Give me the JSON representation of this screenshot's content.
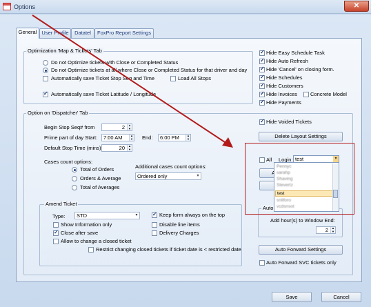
{
  "window": {
    "title": "Options",
    "close_glyph": "✕"
  },
  "tabs": [
    "General",
    "User Profile",
    "Datatel",
    "FoxPro Report Settings"
  ],
  "optimization": {
    "title": "Optimization 'Map & Tickets' Tab",
    "radio1": "Do not Optimize tickets with Close or Completed Status",
    "radio2": "Do not Optimize  tickets at all where Close or Completed Status for that driver and day",
    "auto_save_stop": "Automatically save Ticket Stop Seq and Time",
    "load_all_stops": "Load All Stops",
    "auto_save_latlong": "Automatically save Ticket Latitude / Longitude"
  },
  "right_checks": [
    "Hide Easy Schedule Task",
    "Hide Auto Refresh",
    "Hide 'Cancel' on closing form.",
    "Hide Schedules",
    "Hide Customers",
    "Hide Invoices",
    "Hide Payments"
  ],
  "concrete_model": "Concrete Model",
  "dispatcher": {
    "title": "Option on 'Dispatcher' Tab",
    "begin_stop_label": "Begin Stop Seq# from",
    "begin_stop_value": "2",
    "prime_label": "Prime part of day Start:",
    "prime_start": "7:00 AM",
    "end_label": "End:",
    "prime_end": "6:00 PM",
    "default_stop_label": "Default Stop Time (mins):",
    "default_stop_value": "20",
    "cases_label": "Cases count options:",
    "case_radios": [
      "Total of Orders",
      "Orders & Average",
      "Total of Averages"
    ],
    "additional_label": "Additional cases count options:",
    "additional_value": "Ordered only",
    "hide_voided": "Hide Voided Tickets",
    "delete_layout": "Delete Layout Settings",
    "all_label": "All",
    "login_label": "Login:",
    "login_value": "test",
    "apply_btn": "Apply Sup",
    "copy_btn": "Copy Us",
    "dropdown_items": [
      "Pennyc",
      "sarahp",
      "Shaving",
      "Stevertz",
      "test",
      "snliforo",
      "vcdsnsot"
    ],
    "auto_edit_title": "Auto Edit",
    "add_hours_label": "Add hour(s) to Window End:",
    "add_hours_value": "2",
    "auto_forward_btn": "Auto Forward Settings",
    "auto_forward_svc": "Auto Forward SVC tickets only"
  },
  "amend": {
    "title": "Amend Ticket",
    "type_label": "Type:",
    "type_value": "STD",
    "keep_on_top": "Keep form always on the top",
    "show_info": "Show Information only",
    "disable_line": "Disable line items",
    "close_after_save": "Close after save",
    "delivery_charges": "Delivery Charges",
    "allow_change": "Allow to change a closed ticket",
    "restrict": "Restrict changing closed tickets if ticket date is < restricted date"
  },
  "footer": {
    "save": "Save",
    "cancel": "Cancel"
  },
  "colors": {
    "annotation_red": "#b31b1b",
    "accent_blue": "#1c3b78"
  }
}
